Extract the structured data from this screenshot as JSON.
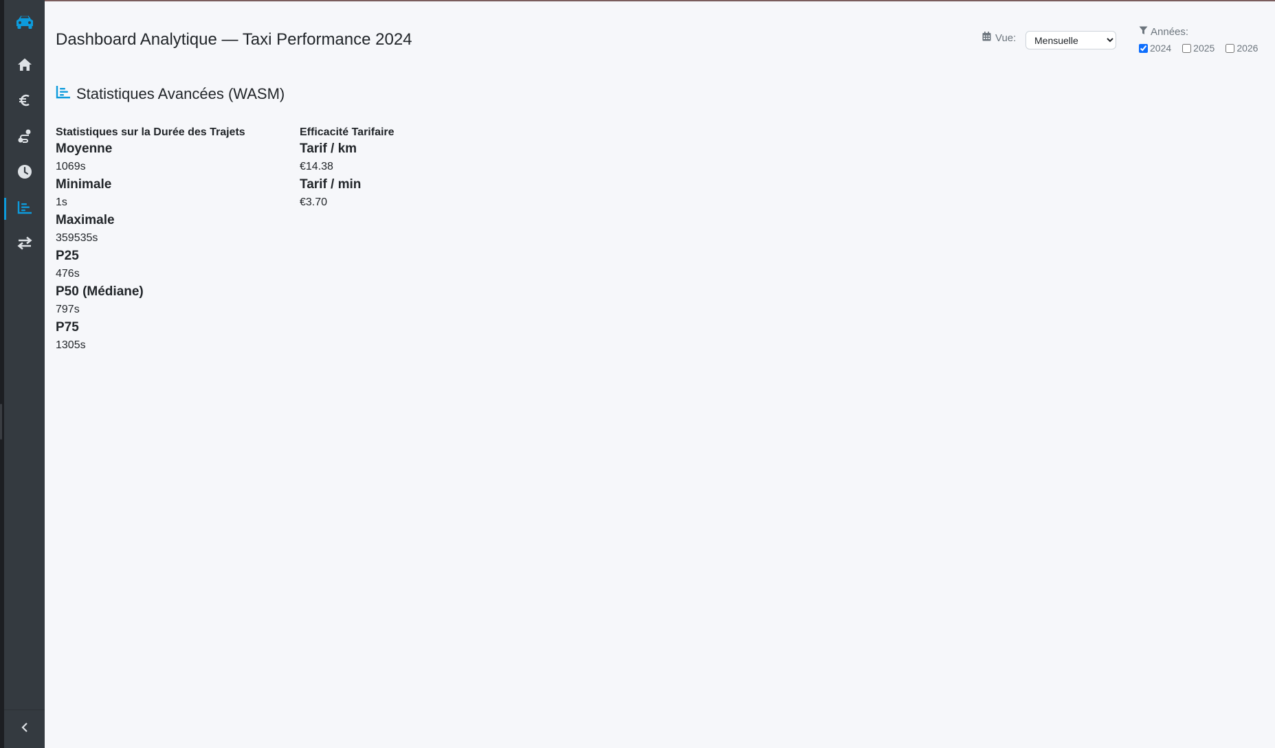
{
  "sidebar": {
    "logo_icon": "taxi-icon",
    "items": [
      {
        "icon": "home-icon",
        "active": false
      },
      {
        "icon": "euro-icon",
        "active": false
      },
      {
        "icon": "route-icon",
        "active": false
      },
      {
        "icon": "clock-icon",
        "active": false
      },
      {
        "icon": "chart-bar-icon",
        "active": true
      },
      {
        "icon": "transfer-icon",
        "active": false
      }
    ],
    "collapse_icon": "chevron-left-icon"
  },
  "header": {
    "title": "Dashboard Analytique — Taxi Performance 2024",
    "view_label": "Vue:",
    "view_selected": "Mensuelle",
    "years_label": "Années:",
    "years": [
      {
        "label": "2024",
        "checked": true
      },
      {
        "label": "2025",
        "checked": false
      },
      {
        "label": "2026",
        "checked": false
      }
    ]
  },
  "section": {
    "title": "Statistiques Avancées (WASM)"
  },
  "duration_stats": {
    "title": "Statistiques sur la Durée des Trajets",
    "items": [
      {
        "label": "Moyenne",
        "value": "1069s"
      },
      {
        "label": "Minimale",
        "value": "1s"
      },
      {
        "label": "Maximale",
        "value": "359535s"
      },
      {
        "label": "P25",
        "value": "476s"
      },
      {
        "label": "P50 (Médiane)",
        "value": "797s"
      },
      {
        "label": "P75",
        "value": "1305s"
      }
    ]
  },
  "fare_efficiency": {
    "title": "Efficacité Tarifaire",
    "items": [
      {
        "label": "Tarif / km",
        "value": "€14.38"
      },
      {
        "label": "Tarif / min",
        "value": "€3.70"
      }
    ]
  },
  "colors": {
    "accent": "#0d9bdc",
    "sidebar_bg": "#343a40",
    "sidebar_icon": "#dee2e6",
    "page_bg": "#f6f7fa"
  }
}
